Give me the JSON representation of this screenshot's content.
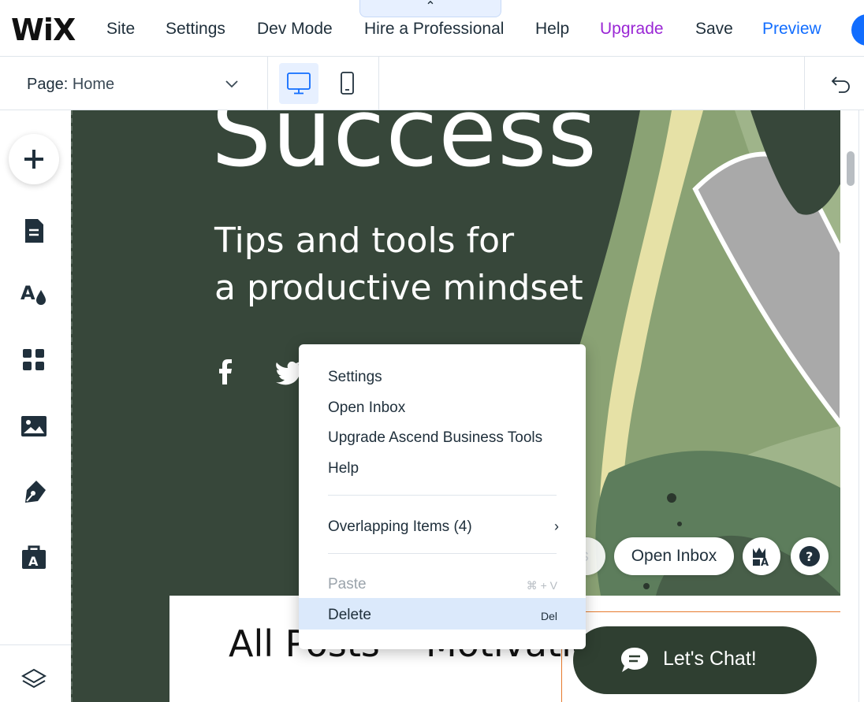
{
  "topbar": {
    "logo": "WiX",
    "menu": [
      "Site",
      "Settings",
      "Dev Mode",
      "Hire a Professional",
      "Help",
      "Upgrade",
      "Save",
      "Preview"
    ],
    "collapse_icon": "chevron-up-icon",
    "upgrade_color": "#9a27d5",
    "preview_color": "#116dff"
  },
  "pagebar": {
    "page_prefix": "Page:",
    "page_value": "Home",
    "desktop_icon": "desktop-icon",
    "mobile_icon": "mobile-icon",
    "undo_icon": "undo-icon"
  },
  "sidebar": {
    "items": [
      "add-icon",
      "pages-icon",
      "design-icon",
      "apps-icon",
      "media-icon",
      "blog-icon",
      "business-icon",
      "layers-icon"
    ]
  },
  "canvas": {
    "hero": "Success",
    "subtitle_line1": "Tips and tools for",
    "subtitle_line2": "a productive mindset",
    "posts": "All Posts",
    "motivation": "Motivatio"
  },
  "floating": {
    "settings": "Settings",
    "open_inbox": "Open Inbox"
  },
  "chat": {
    "label": "Let's Chat!"
  },
  "context_menu": {
    "items": [
      "Settings",
      "Open Inbox",
      "Upgrade Ascend Business Tools",
      "Help"
    ],
    "overlapping": "Overlapping Items (4)",
    "paste": "Paste",
    "paste_shortcut": "⌘ + V",
    "delete": "Delete",
    "delete_shortcut": "Del"
  },
  "colors": {
    "canvas_bg": "#37473a",
    "accent": "#116dff",
    "highlight": "#dbe9fb"
  }
}
